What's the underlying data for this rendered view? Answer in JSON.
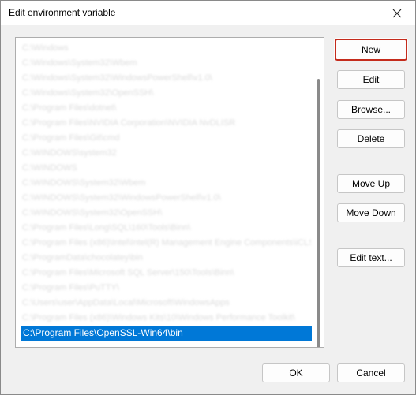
{
  "window": {
    "title": "Edit environment variable"
  },
  "list": {
    "items": [
      "C:\\Windows",
      "C:\\Windows\\System32\\Wbem",
      "C:\\Windows\\System32\\WindowsPowerShell\\v1.0\\",
      "C:\\Windows\\System32\\OpenSSH\\",
      "C:\\Program Files\\dotnet\\",
      "C:\\Program Files\\NVIDIA Corporation\\NVIDIA NvDLISR",
      "C:\\Program Files\\Git\\cmd",
      "C:\\WINDOWS\\system32",
      "C:\\WINDOWS",
      "C:\\WINDOWS\\System32\\Wbem",
      "C:\\WINDOWS\\System32\\WindowsPowerShell\\v1.0\\",
      "C:\\WINDOWS\\System32\\OpenSSH\\",
      "C:\\Program Files\\Long\\SQL\\160\\Tools\\Binn\\",
      "C:\\Program Files (x86)\\Intel\\Intel(R) Management Engine Components\\iCLS\\",
      "C:\\ProgramData\\chocolatey\\bin",
      "C:\\Program Files\\Microsoft SQL Server\\150\\Tools\\Binn\\",
      "C:\\Program Files\\PuTTY\\",
      "C:\\Users\\user\\AppData\\Local\\Microsoft\\WindowsApps",
      "C:\\Program Files (x86)\\Windows Kits\\10\\Windows Performance Toolkit\\",
      "C:\\Program Files\\OpenSSL-Win64\\bin"
    ],
    "selected_index": 19,
    "selected_label": "C:\\Program Files\\OpenSSL-Win64\\bin"
  },
  "buttons": {
    "new": "New",
    "edit": "Edit",
    "browse": "Browse...",
    "delete": "Delete",
    "move_up": "Move Up",
    "move_down": "Move Down",
    "edit_text": "Edit text...",
    "ok": "OK",
    "cancel": "Cancel"
  },
  "colors": {
    "selection": "#0078d7",
    "default_button_border": "#c42b1c"
  }
}
